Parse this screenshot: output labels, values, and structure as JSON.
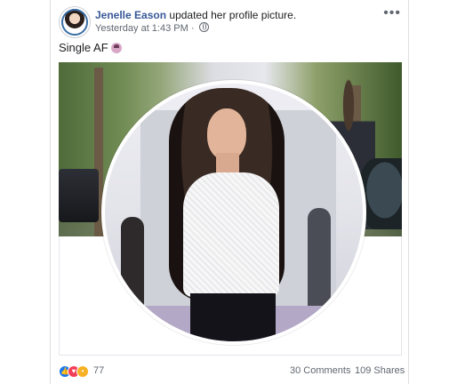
{
  "post": {
    "author": "Jenelle Eason",
    "action": "updated her profile picture.",
    "timestamp": "Yesterday at 1:43 PM",
    "audience_icon": "globe-icon",
    "more_label": "•••",
    "text": "Single AF",
    "emoji": "woman-emoji"
  },
  "footer": {
    "reactions": [
      "like",
      "love",
      "wow"
    ],
    "reaction_count": "77",
    "comments": "30 Comments",
    "shares": "109 Shares"
  },
  "colors": {
    "name_link": "#385898",
    "meta_text": "#606770",
    "like": "#1877f2",
    "love": "#f33e58",
    "wow": "#f7b125"
  }
}
